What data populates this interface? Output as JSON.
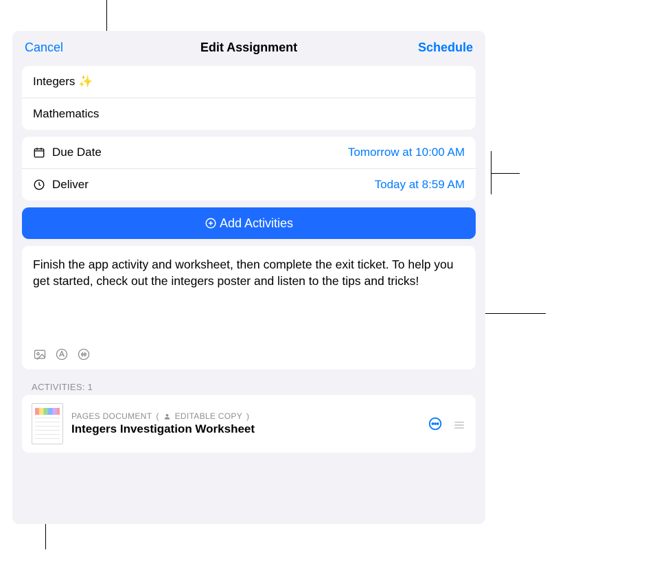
{
  "header": {
    "cancel": "Cancel",
    "title": "Edit Assignment",
    "schedule": "Schedule"
  },
  "name_section": {
    "title": "Integers ✨",
    "class": "Mathematics"
  },
  "dates": {
    "due_label": "Due Date",
    "due_value": "Tomorrow at 10:00 AM",
    "deliver_label": "Deliver",
    "deliver_value": "Today at 8:59 AM"
  },
  "add_activities_label": "Add Activities",
  "instructions": "Finish the app activity and worksheet, then complete the exit ticket. To help you get started, check out the integers poster and listen to the tips and tricks!",
  "activities_header": "ACTIVITIES: 1",
  "activity": {
    "type": "PAGES DOCUMENT",
    "copy_label": "EDITABLE COPY",
    "title": "Integers Investigation Worksheet"
  }
}
